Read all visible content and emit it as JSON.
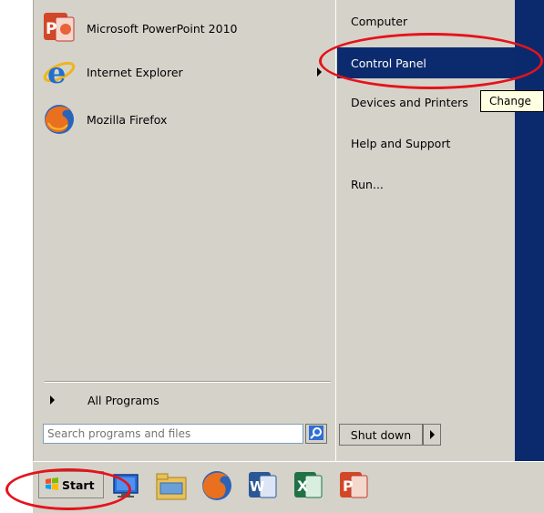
{
  "programs": [
    {
      "label": "Microsoft PowerPoint 2010",
      "icon": "powerpoint-icon",
      "has_submenu": false
    },
    {
      "label": "Internet Explorer",
      "icon": "internet-explorer-icon",
      "has_submenu": true
    },
    {
      "label": "Mozilla Firefox",
      "icon": "firefox-icon",
      "has_submenu": false
    }
  ],
  "all_programs": "All Programs",
  "search": {
    "value": "",
    "placeholder": "Search programs and files"
  },
  "places": [
    {
      "label": "Computer",
      "selected": false
    },
    {
      "label": "Control Panel",
      "selected": true
    },
    {
      "label": "Devices and Printers",
      "selected": false
    },
    {
      "label": "Help and Support",
      "selected": false
    },
    {
      "label": "Run...",
      "selected": false
    }
  ],
  "tooltip": "Change",
  "shutdown": {
    "label": "Shut down"
  },
  "taskbar": {
    "start_label": "Start",
    "pinned": [
      "show-desktop-icon",
      "file-explorer-icon",
      "firefox-icon",
      "word-icon",
      "excel-icon",
      "powerpoint-icon"
    ]
  },
  "colors": {
    "selection": "#0c2b6e",
    "highlight_ring": "#e5131b",
    "menu_bg": "#d5d2ca"
  }
}
